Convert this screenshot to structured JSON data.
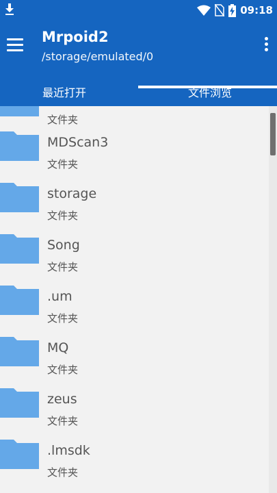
{
  "status_bar": {
    "time": "09:18",
    "icons": [
      "download-icon",
      "wifi-icon",
      "no-sim-icon",
      "battery-charging-icon"
    ]
  },
  "app_bar": {
    "title": "Mrpoid2",
    "path": "/storage/emulated/0"
  },
  "tabs": [
    {
      "label": "最近打开",
      "selected": false
    },
    {
      "label": "文件浏览",
      "selected": true
    }
  ],
  "files": [
    {
      "name": "",
      "type": "文件夹"
    },
    {
      "name": "MDScan3",
      "type": "文件夹"
    },
    {
      "name": "storage",
      "type": "文件夹"
    },
    {
      "name": "Song",
      "type": "文件夹"
    },
    {
      "name": ".um",
      "type": "文件夹"
    },
    {
      "name": "MQ",
      "type": "文件夹"
    },
    {
      "name": "zeus",
      "type": "文件夹"
    },
    {
      "name": ".lmsdk",
      "type": "文件夹"
    }
  ],
  "colors": {
    "primary": "#1565c0",
    "folder": "#64a8e8",
    "text": "#555555"
  }
}
